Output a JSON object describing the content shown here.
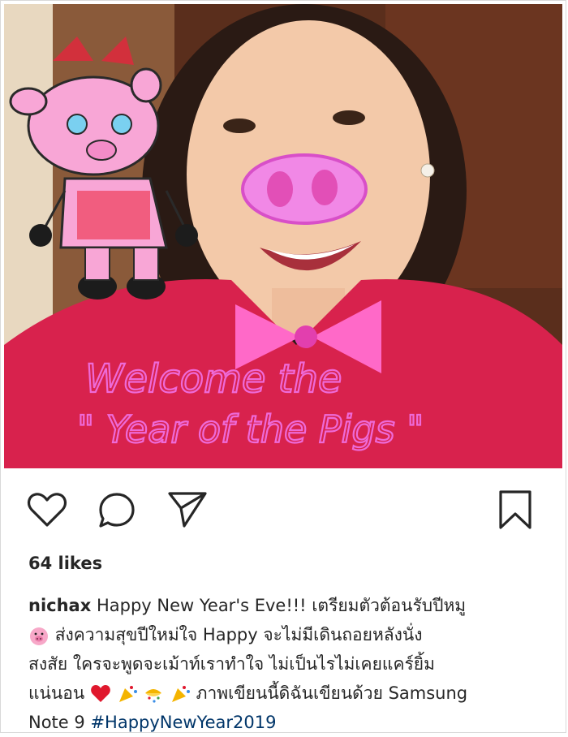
{
  "photo": {
    "overlay_line1": "Welcome the",
    "overlay_line2": "\" Year of the Pigs \"",
    "colors": {
      "sweater": "#d8224d",
      "overlay_pink": "#ee6ad8",
      "wall": "#5a2e1c"
    }
  },
  "actions": {
    "like_icon": "heart-icon",
    "comment_icon": "comment-icon",
    "share_icon": "paper-plane-icon",
    "save_icon": "bookmark-icon"
  },
  "post": {
    "likes": "64 likes",
    "username": "nichax",
    "caption_line1": "Happy New Year's Eve!!! เตรียมตัวต้อนรับปีหมู",
    "caption_line2": "ส่งความสุขปีใหม่ใจ Happy จะไม่มีเดินถอยหลังนั่ง",
    "caption_line3": "สงสัย ใครจะพูดจะเม้าท์เราทำใจ ไม่เป็นไรไม่เคยแคร์ยิ้ม",
    "caption_line4_a": "แน่นอน",
    "caption_line4_b": "ภาพเขียนนี้ดิฉันเขียนด้วย Samsung",
    "caption_line5": "Note 9",
    "hashtag": "#HappyNewYear2019"
  }
}
